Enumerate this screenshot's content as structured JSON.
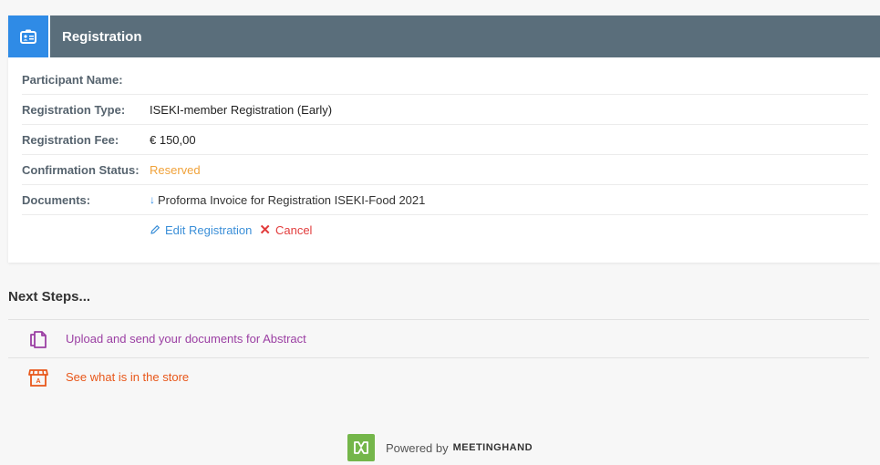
{
  "card": {
    "title": "Registration",
    "rows": [
      {
        "label": "Participant Name:",
        "value": ""
      },
      {
        "label": "Registration Type:",
        "value": "ISEKI-member Registration (Early)"
      },
      {
        "label": "Registration Fee:",
        "value": "€ 150,00"
      },
      {
        "label": "Confirmation Status:",
        "value": "Reserved"
      },
      {
        "label": "Documents:",
        "value": "Proforma Invoice for Registration ISEKI-Food 2021"
      }
    ],
    "actions": {
      "edit_label": "Edit Registration",
      "cancel_label": "Cancel"
    }
  },
  "next_steps": {
    "title": "Next Steps...",
    "items": [
      {
        "label": "Upload and send your documents for Abstract",
        "icon": "documents-icon"
      },
      {
        "label": "See what is in the store",
        "icon": "store-icon"
      }
    ]
  },
  "footer": {
    "powered": "Powered by",
    "brand": "MEETINGHAND"
  },
  "colors": {
    "header": "#5a6e7b",
    "accent": "#2f8be6",
    "status_reserved": "#f0a23a",
    "purple": "#9b3fa3",
    "orange": "#e8571a",
    "cancel": "#e23d3d",
    "logo_green": "#74b64a"
  }
}
